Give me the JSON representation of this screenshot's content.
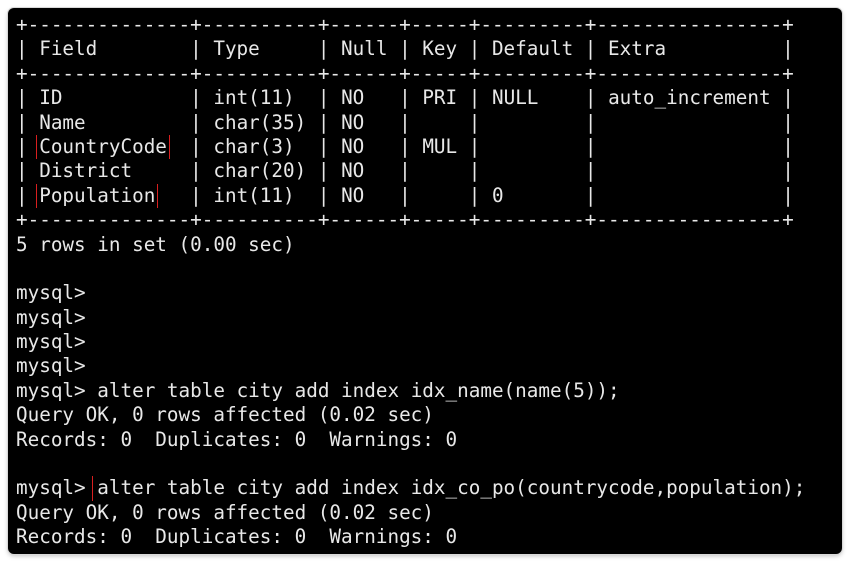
{
  "table": {
    "border": "+--------------+----------+------+-----+---------+----------------+",
    "header": "| Field        | Type     | Null | Key | Default | Extra          |",
    "rows": [
      {
        "field": "ID",
        "type": "int(11)",
        "null": "NO",
        "key": "PRI",
        "default": "NULL",
        "extra": "auto_increment"
      },
      {
        "field": "Name",
        "type": "char(35)",
        "null": "NO",
        "key": "",
        "default": "",
        "extra": ""
      },
      {
        "field": "CountryCode",
        "type": "char(3)",
        "null": "NO",
        "key": "MUL",
        "default": "",
        "extra": ""
      },
      {
        "field": "District",
        "type": "char(20)",
        "null": "NO",
        "key": "",
        "default": "",
        "extra": ""
      },
      {
        "field": "Population",
        "type": "int(11)",
        "null": "NO",
        "key": "",
        "default": "0",
        "extra": ""
      }
    ],
    "summary": "5 rows in set (0.00 sec)"
  },
  "session": {
    "prompt": "mysql> ",
    "empty_prompt": "mysql>",
    "cmd1": "alter table city add index idx_name(name(5));",
    "cmd1_result1": "Query OK, 0 rows affected (0.02 sec)",
    "cmd1_result2": "Records: 0  Duplicates: 0  Warnings: 0",
    "cmd2": "alter table city add index idx_co_po(countrycode,population);",
    "cmd2_result1": "Query OK, 0 rows affected (0.02 sec)",
    "cmd2_result2": "Records: 0  Duplicates: 0  Warnings: 0"
  },
  "colors": {
    "background": "#000000",
    "text": "#e8e8e8",
    "highlight_box": "#d81f1f"
  }
}
